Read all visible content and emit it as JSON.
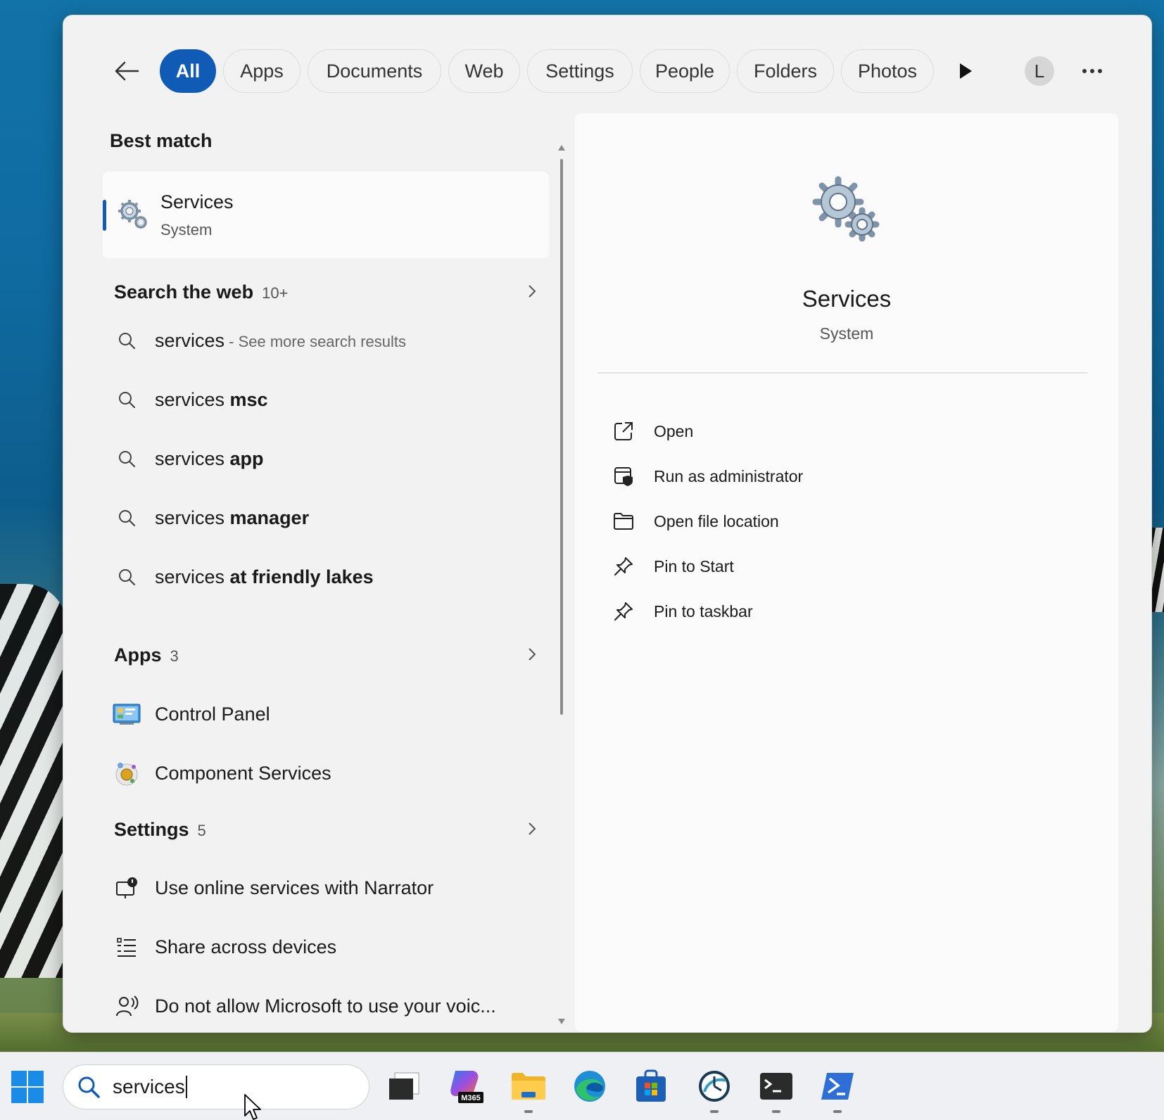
{
  "filters": {
    "items": [
      "All",
      "Apps",
      "Documents",
      "Web",
      "Settings",
      "People",
      "Folders",
      "Photos"
    ],
    "active": "All",
    "avatar_letter": "L"
  },
  "best_match": {
    "heading": "Best match",
    "name": "Services",
    "type": "System"
  },
  "web": {
    "heading": "Search the web",
    "count": "10+",
    "results": [
      {
        "prefix": "services",
        "bold": "",
        "suffix": " - See more search results"
      },
      {
        "prefix": "services ",
        "bold": "msc",
        "suffix": ""
      },
      {
        "prefix": "services ",
        "bold": "app",
        "suffix": ""
      },
      {
        "prefix": "services ",
        "bold": "manager",
        "suffix": ""
      },
      {
        "prefix": "services ",
        "bold": "at friendly lakes",
        "suffix": ""
      }
    ]
  },
  "apps": {
    "heading": "Apps",
    "count": "3",
    "items": [
      "Control Panel",
      "Component Services"
    ]
  },
  "settings": {
    "heading": "Settings",
    "count": "5",
    "items": [
      "Use online services with Narrator",
      "Share across devices",
      "Do not allow Microsoft to use your voic..."
    ]
  },
  "preview": {
    "title": "Services",
    "subtitle": "System",
    "actions": [
      "Open",
      "Run as administrator",
      "Open file location",
      "Pin to Start",
      "Pin to taskbar"
    ]
  },
  "taskbar": {
    "search_value": "services",
    "icons": [
      "task-view-icon",
      "microsoft-365-copilot-icon",
      "file-explorer-icon",
      "edge-icon",
      "microsoft-store-icon",
      "clock-app-icon",
      "terminal-icon",
      "powershell-icon"
    ],
    "m365_badge": "M365"
  },
  "colors": {
    "accent": "#0f5bb5"
  }
}
